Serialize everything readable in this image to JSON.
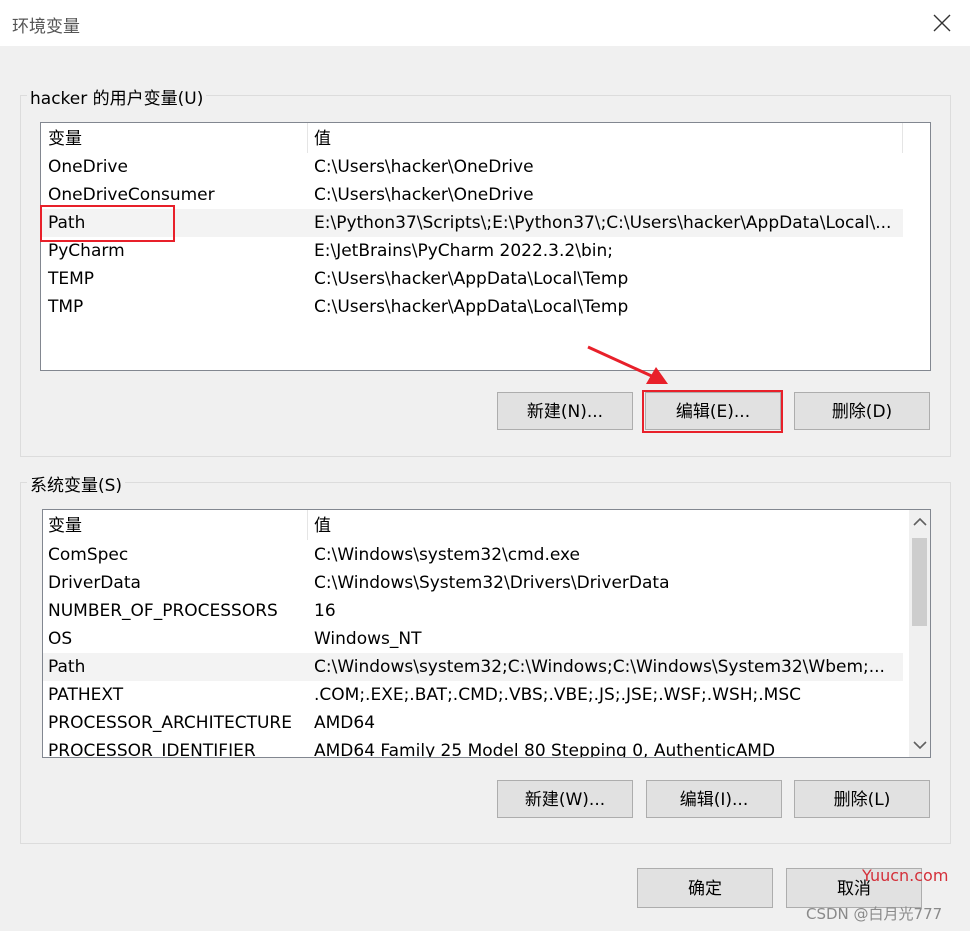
{
  "window": {
    "title": "环境变量"
  },
  "user_vars": {
    "group_label": "hacker 的用户变量(U)",
    "columns": [
      "变量",
      "值"
    ],
    "rows": [
      {
        "name": "OneDrive",
        "value": "C:\\Users\\hacker\\OneDrive"
      },
      {
        "name": "OneDriveConsumer",
        "value": "C:\\Users\\hacker\\OneDrive"
      },
      {
        "name": "Path",
        "value": "E:\\Python37\\Scripts\\;E:\\Python37\\;C:\\Users\\hacker\\AppData\\Local\\..."
      },
      {
        "name": "PyCharm",
        "value": "E:\\JetBrains\\PyCharm 2022.3.2\\bin;"
      },
      {
        "name": "TEMP",
        "value": "C:\\Users\\hacker\\AppData\\Local\\Temp"
      },
      {
        "name": "TMP",
        "value": "C:\\Users\\hacker\\AppData\\Local\\Temp"
      }
    ],
    "buttons": {
      "new": "新建(N)...",
      "edit": "编辑(E)...",
      "delete": "删除(D)"
    }
  },
  "sys_vars": {
    "group_label": "系统变量(S)",
    "columns": [
      "变量",
      "值"
    ],
    "rows": [
      {
        "name": "ComSpec",
        "value": "C:\\Windows\\system32\\cmd.exe"
      },
      {
        "name": "DriverData",
        "value": "C:\\Windows\\System32\\Drivers\\DriverData"
      },
      {
        "name": "NUMBER_OF_PROCESSORS",
        "value": "16"
      },
      {
        "name": "OS",
        "value": "Windows_NT"
      },
      {
        "name": "Path",
        "value": "C:\\Windows\\system32;C:\\Windows;C:\\Windows\\System32\\Wbem;..."
      },
      {
        "name": "PATHEXT",
        "value": ".COM;.EXE;.BAT;.CMD;.VBS;.VBE;.JS;.JSE;.WSF;.WSH;.MSC"
      },
      {
        "name": "PROCESSOR_ARCHITECTURE",
        "value": "AMD64"
      },
      {
        "name": "PROCESSOR_IDENTIFIER",
        "value": "AMD64 Family 25 Model 80 Stepping 0, AuthenticAMD"
      }
    ],
    "buttons": {
      "new": "新建(W)...",
      "edit": "编辑(I)...",
      "delete": "删除(L)"
    }
  },
  "footer": {
    "ok": "确定",
    "cancel": "取消"
  },
  "watermark": {
    "site": "Yuucn.com",
    "credit": "CSDN @白月光777"
  },
  "icons": {
    "close": "close-icon",
    "scroll_up": "chevron-up-icon",
    "scroll_down": "chevron-down-icon",
    "annotation": "arrow-icon"
  },
  "colors": {
    "highlight": "#e8202a",
    "selected_row": "#f3f3f3",
    "watermark_site": "#d4303a"
  }
}
